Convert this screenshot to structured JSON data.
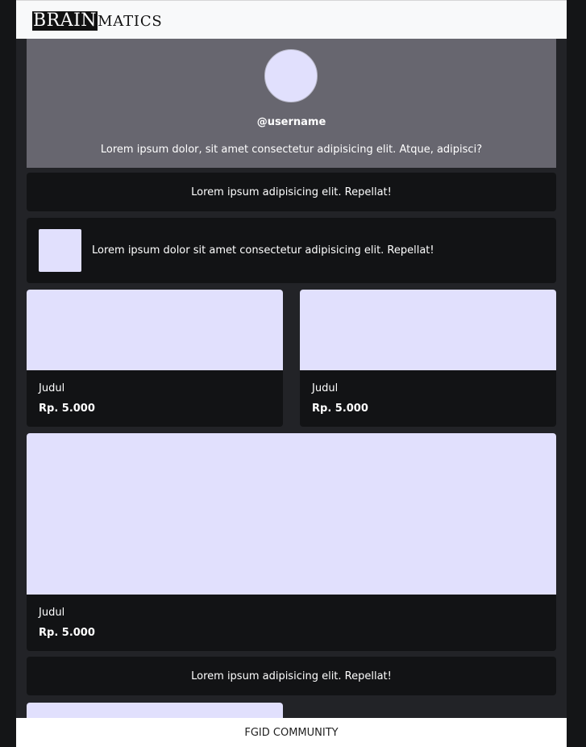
{
  "brand": {
    "logo_highlight": "Brain",
    "logo_rest": "matics"
  },
  "profile": {
    "username": "@username",
    "bio": "Lorem ipsum dolor, sit amet consectetur adipisicing elit. Atque, adipisci?"
  },
  "links": [
    {
      "label": "Lorem ipsum adipisicing elit. Repellat!"
    },
    {
      "label": "Lorem ipsum dolor sit amet consectetur adipisicing elit. Repellat!"
    },
    {
      "label": "Lorem ipsum adipisicing elit. Repellat!"
    }
  ],
  "products": [
    {
      "title": "Judul",
      "price": "Rp. 5.000"
    },
    {
      "title": "Judul",
      "price": "Rp. 5.000"
    },
    {
      "title": "Judul",
      "price": "Rp. 5.000"
    }
  ],
  "footer": {
    "label": "FGID COMMUNITY"
  },
  "colors": {
    "placeholder": "#e1e0fd",
    "card": "#121315",
    "profile_bg": "#67666f"
  }
}
